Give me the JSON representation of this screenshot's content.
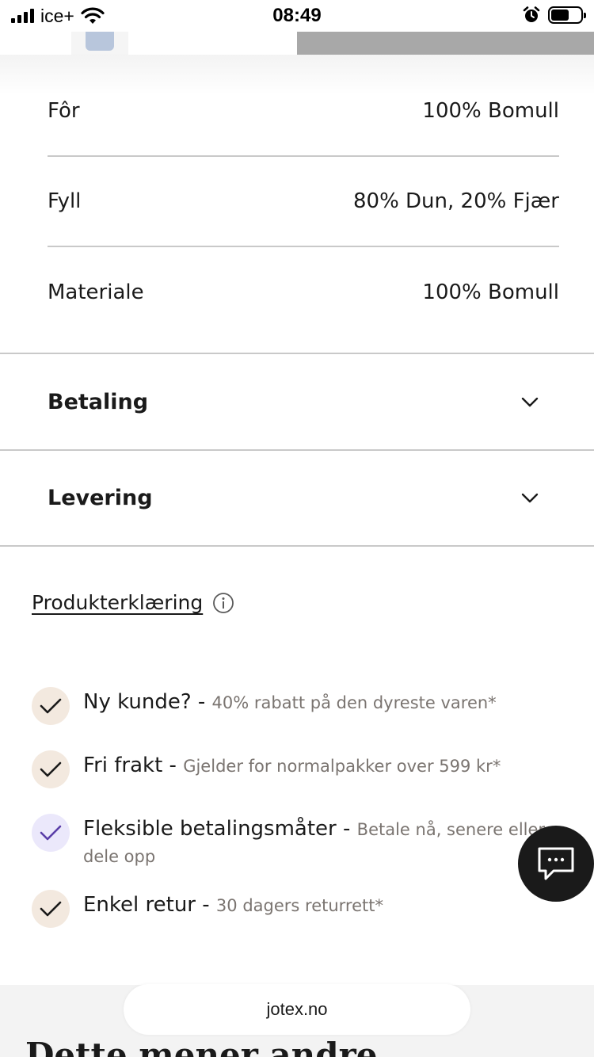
{
  "status_bar": {
    "carrier": "ice+",
    "time": "08:49",
    "battery_level": 0.6
  },
  "specs": [
    {
      "label": "Fôr",
      "value": "100% Bomull"
    },
    {
      "label": "Fyll",
      "value": "80% Dun, 20% Fjær"
    },
    {
      "label": "Materiale",
      "value": "100% Bomull"
    }
  ],
  "accordions": [
    {
      "title": "Betaling",
      "icon": "chevron-down-icon"
    },
    {
      "title": "Levering",
      "icon": "chevron-down-icon"
    }
  ],
  "declaration": {
    "link": "Produkterklæring",
    "icon": "info-icon"
  },
  "usps": [
    {
      "title": "Ny kunde?",
      "separator": " - ",
      "detail": "40% rabatt på den dyreste varen*",
      "check_bg": "#f3e9df",
      "check_color": "#1a1a1a"
    },
    {
      "title": "Fri frakt",
      "separator": " - ",
      "detail": "Gjelder for normalpakker over 599 kr*",
      "check_bg": "#f3e9df",
      "check_color": "#1a1a1a"
    },
    {
      "title": "Fleksible betalingsmåter",
      "separator": " - ",
      "detail": "Betale nå, senere eller dele opp",
      "check_bg": "#ebe8fb",
      "check_color": "#5a3ea8"
    },
    {
      "title": "Enkel retur",
      "separator": " - ",
      "detail": "30 dagers returrett*",
      "check_bg": "#f3e9df",
      "check_color": "#1a1a1a"
    }
  ],
  "chat": {
    "icon": "chat-icon"
  },
  "browser": {
    "url": "jotex.no"
  },
  "next_section": {
    "heading": "Dette mener andre"
  }
}
